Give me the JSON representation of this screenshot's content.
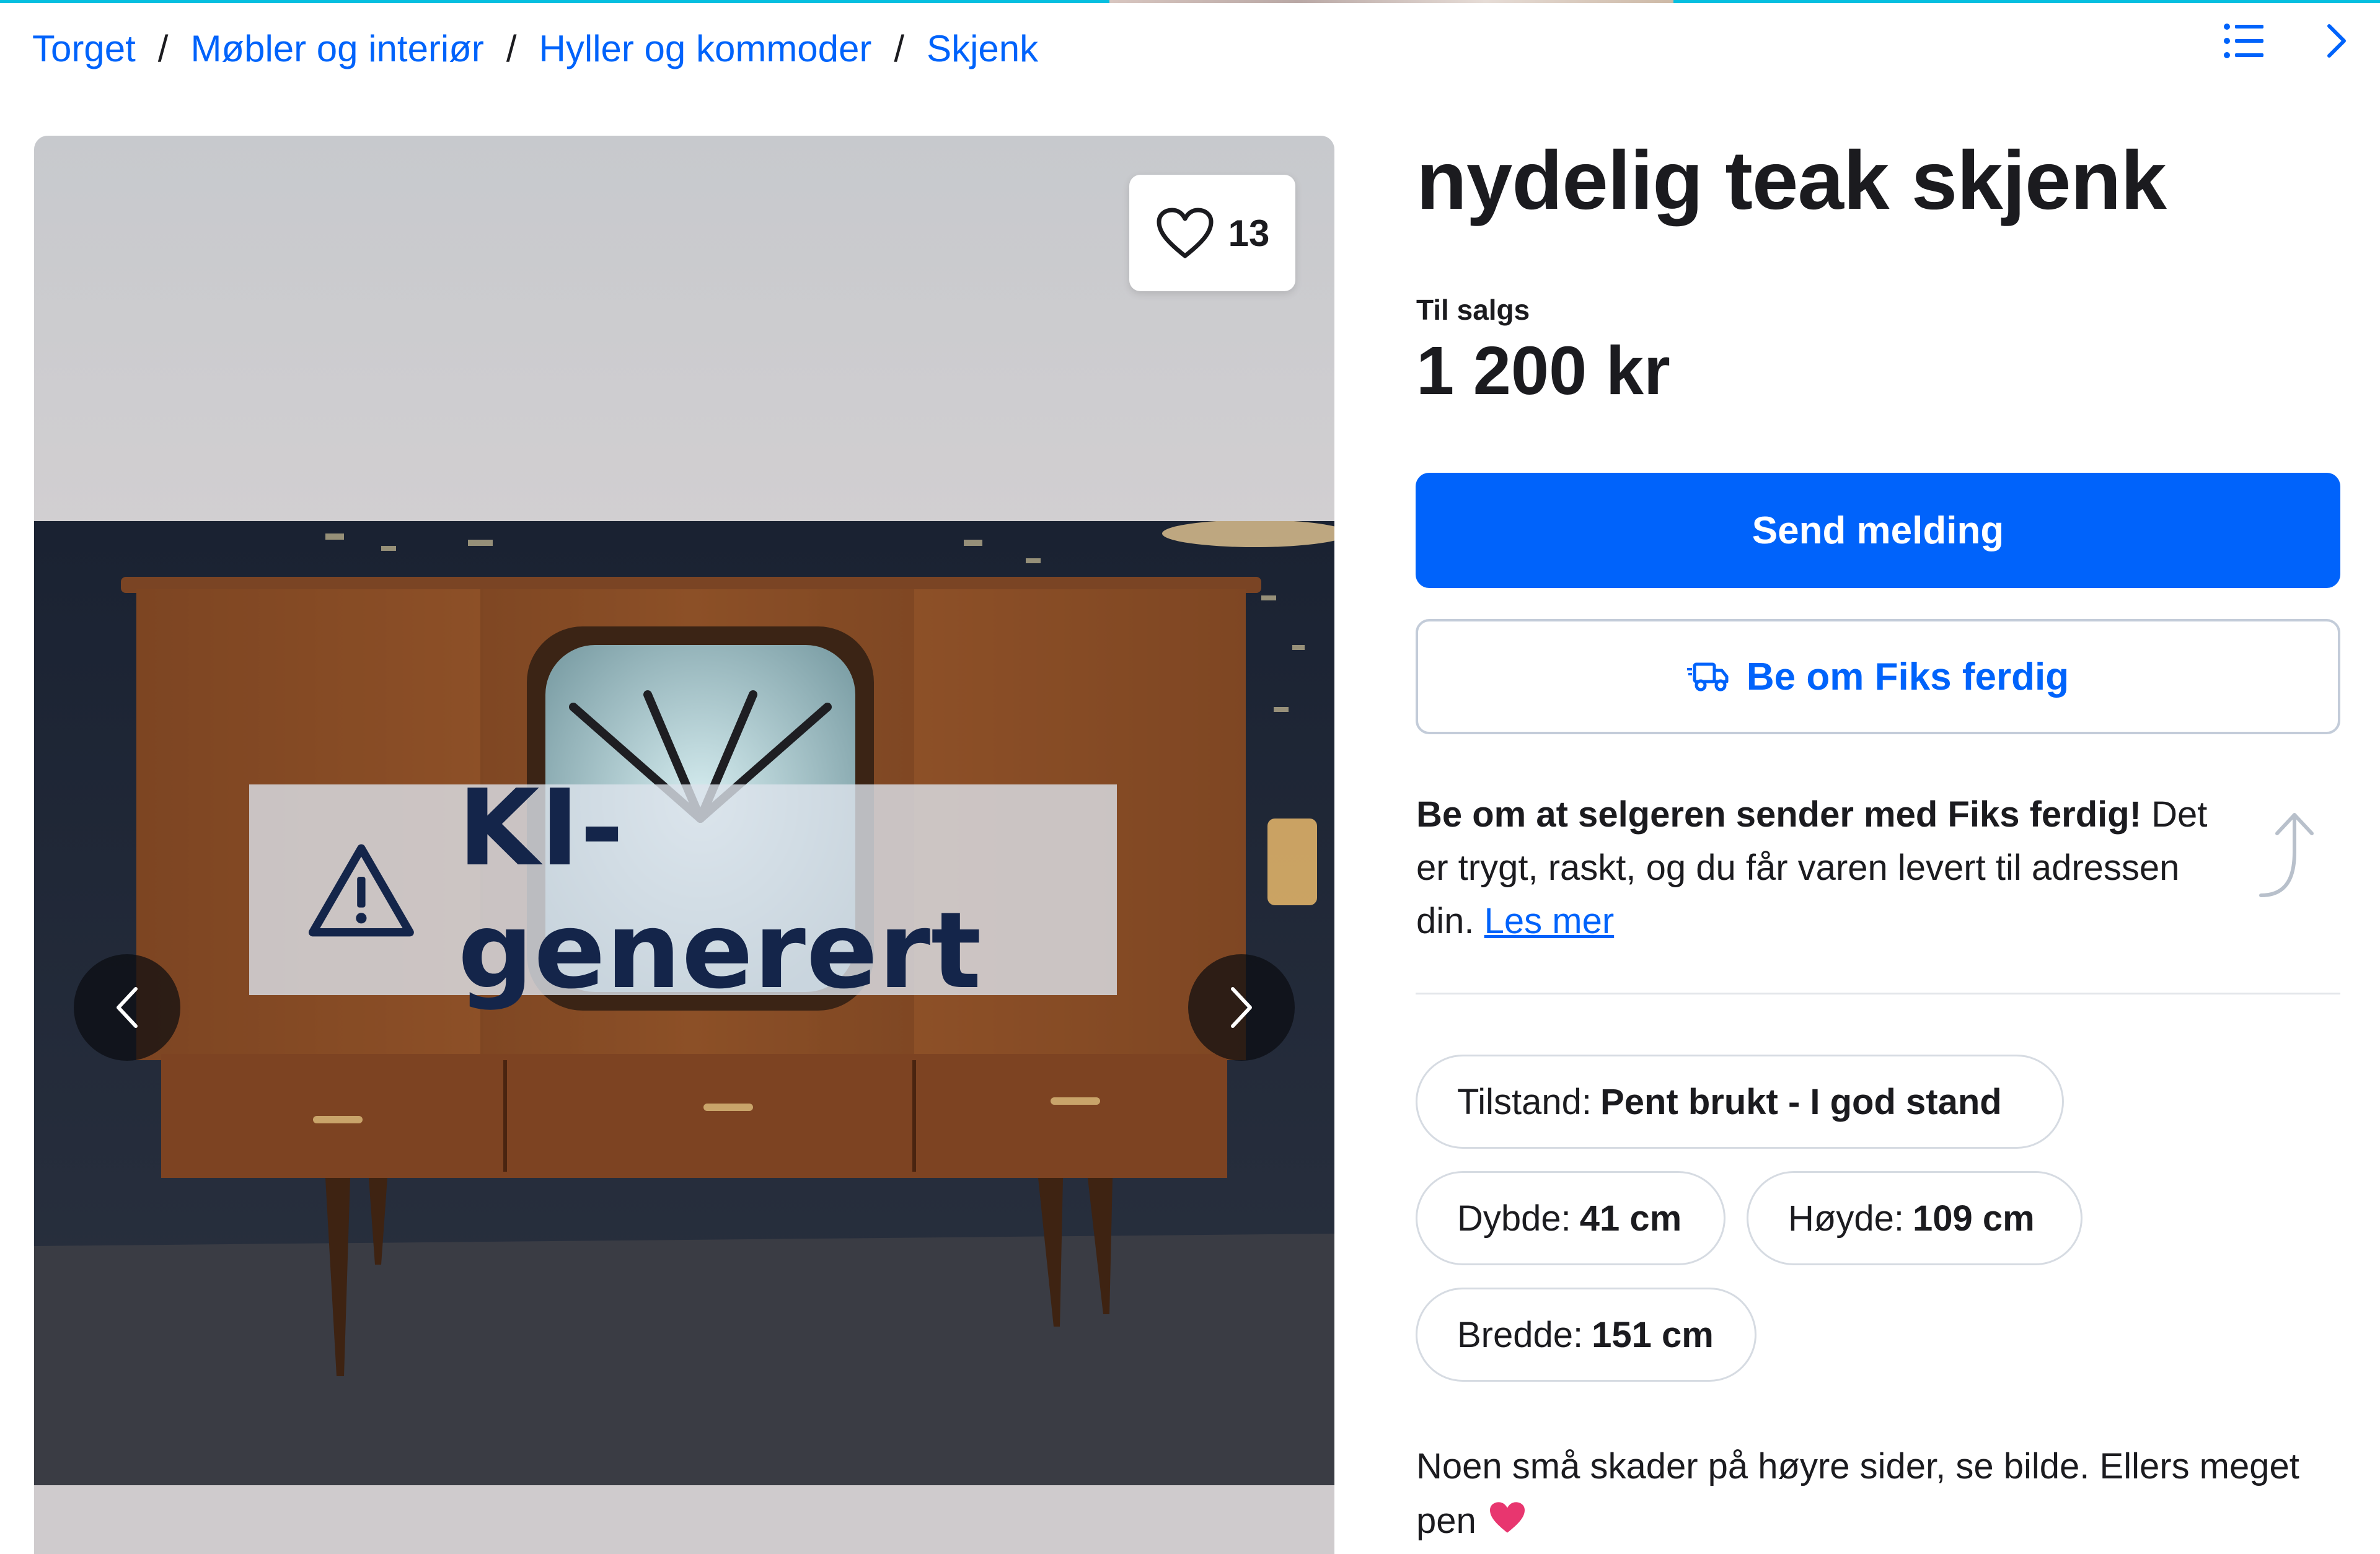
{
  "breadcrumb": [
    {
      "label": "Torget"
    },
    {
      "label": "Møbler og interiør"
    },
    {
      "label": "Hyller og kommoder"
    },
    {
      "label": "Skjenk"
    }
  ],
  "breadcrumb_separator": "/",
  "icons": {
    "list": "list-icon",
    "next_ad": "chevron-right-icon",
    "favorite": "heart-icon",
    "ai_warning": "warning-triangle-icon",
    "gallery_prev": "chevron-left-icon",
    "gallery_next": "chevron-right-icon",
    "shipping": "delivery-truck-icon",
    "promo_arrow": "curved-arrow-up-icon",
    "description_emoji": "pink-heart-emoji"
  },
  "gallery": {
    "favorite_count": "13",
    "ai_label": "KI-generert"
  },
  "listing": {
    "title": "nydelig teak skjenk",
    "status": "Til salgs",
    "price": "1 200 kr"
  },
  "actions": {
    "send_message": "Send melding",
    "request_shipping": "Be om Fiks ferdig"
  },
  "promo": {
    "bold": "Be om at selgeren sender med Fiks ferdig!",
    "text": " Det er trygt, raskt, og du får varen levert til adressen din. ",
    "link": "Les mer"
  },
  "attributes": {
    "condition": {
      "label": "Tilstand:",
      "value": "Pent brukt - I god stand"
    },
    "depth": {
      "label": "Dybde:",
      "value": "41 cm"
    },
    "height": {
      "label": "Høyde:",
      "value": "109 cm"
    },
    "width": {
      "label": "Bredde:",
      "value": "151 cm"
    }
  },
  "description": "Noen små skader på høyre sider, se bilde. Ellers meget pen",
  "colors": {
    "accent": "#0063fb",
    "top_bar": "#06bfe0",
    "text": "#1b1b1f",
    "border": "#d6dbe2"
  }
}
